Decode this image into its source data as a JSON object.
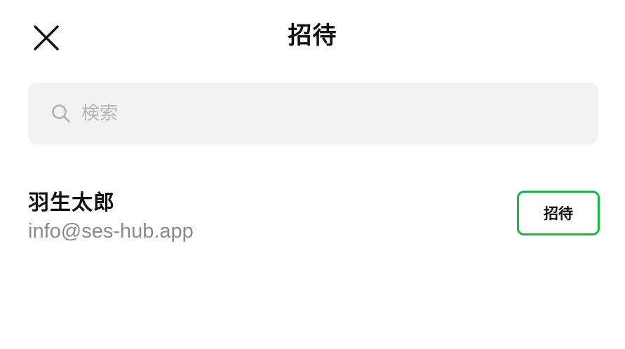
{
  "header": {
    "title": "招待",
    "close_icon": "close-icon"
  },
  "search": {
    "placeholder": "検索",
    "value": "",
    "icon": "search-icon"
  },
  "users": [
    {
      "name": "羽生太郎",
      "email": "info@ses-hub.app",
      "action_label": "招待"
    }
  ],
  "colors": {
    "accent_green": "#1db446",
    "search_bg": "#f2f2f2",
    "secondary_text": "#8a8a8a",
    "placeholder_text": "#b5b5b5"
  }
}
